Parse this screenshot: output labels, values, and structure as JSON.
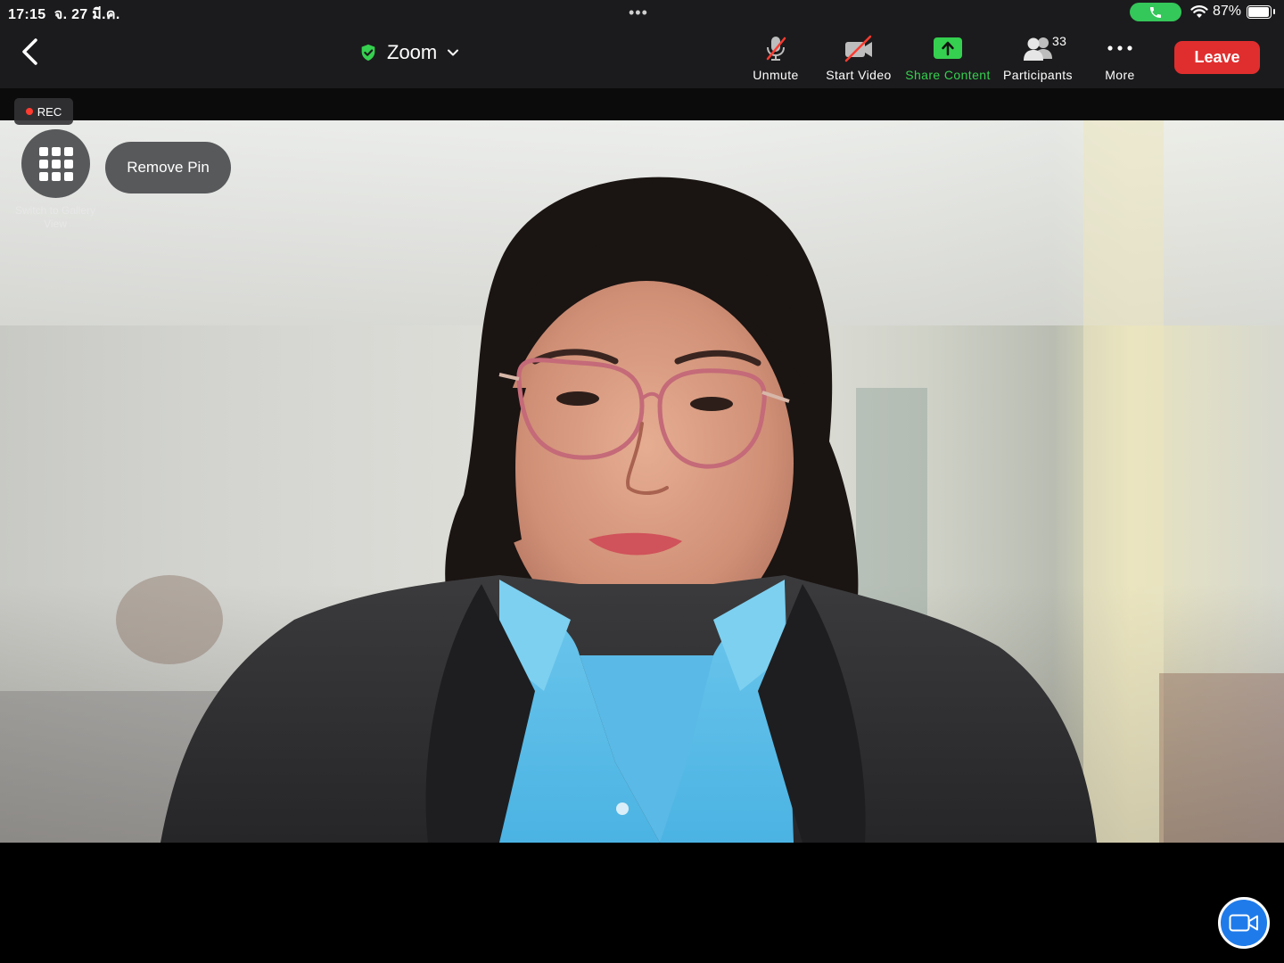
{
  "status_bar": {
    "time": "17:15",
    "date": "จ. 27 มี.ค.",
    "battery_percent": "87%",
    "battery_level": 0.87,
    "call_active": true
  },
  "toolbar": {
    "meeting_title": "Zoom",
    "unmute_label": "Unmute",
    "start_video_label": "Start Video",
    "share_content_label": "Share Content",
    "participants_label": "Participants",
    "participants_count": "33",
    "more_label": "More",
    "leave_label": "Leave"
  },
  "recording": {
    "label": "REC"
  },
  "video_controls": {
    "switch_view_label": "Switch to Gallery View",
    "remove_pin_label": "Remove Pin"
  },
  "colors": {
    "accent_green": "#35d04f",
    "leave_red": "#e02e2e",
    "camera_blue": "#1f7bea"
  }
}
